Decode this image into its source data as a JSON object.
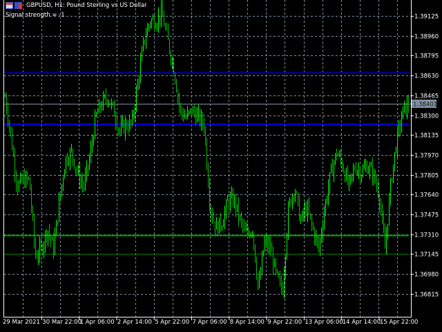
{
  "header": {
    "title": "GBPUSD, H1:  Pound Sterling vs US Dollar",
    "signal": "Signal strength = -1"
  },
  "colors": {
    "background": "#000000",
    "bars": "#00ff00",
    "grid": "#8090a0",
    "line_upper": "#0000c0",
    "line_main": "#0000ff",
    "line_green": "#008000",
    "line_green_low": "#006400",
    "bid_line": "#8090a0"
  },
  "chart_data": {
    "type": "bar",
    "symbol": "GBPUSD",
    "timeframe": "H1",
    "ylim": [
      1.3665,
      1.3926
    ],
    "y_ticks": [
      "1.39125",
      "1.38960",
      "1.38795",
      "1.38630",
      "1.38465",
      "1.38300",
      "1.38135",
      "1.37970",
      "1.37805",
      "1.37640",
      "1.37475",
      "1.37310",
      "1.37145",
      "1.36980",
      "1.36815"
    ],
    "x_ticks": [
      "29 Mar 2021",
      "30 Mar 22:00",
      "1 Apr 06:00",
      "2 Apr 14:00",
      "5 Apr 22:00",
      "7 Apr 06:00",
      "8 Apr 14:00",
      "9 Apr 22:00",
      "13 Apr 06:00",
      "14 Apr 14:00",
      "15 Apr 22:00"
    ],
    "current_price": "1.38401",
    "horizontal_lines": [
      {
        "name": "upper-blue",
        "price": 1.3866,
        "color": "#0000c0"
      },
      {
        "name": "main-blue",
        "price": 1.3823,
        "color": "#0000ff"
      },
      {
        "name": "green",
        "price": 1.373,
        "color": "#00a000"
      },
      {
        "name": "green-low",
        "price": 1.3715,
        "color": "#007000"
      }
    ],
    "price_trace": [
      1.38452,
      1.38107,
      1.37705,
      1.37762,
      1.37762,
      1.3713,
      1.37187,
      1.3736,
      1.37187,
      1.3759,
      1.37935,
      1.37992,
      1.3782,
      1.37705,
      1.37935,
      1.3828,
      1.38395,
      1.38452,
      1.38337,
      1.38165,
      1.38222,
      1.38222,
      1.38567,
      1.38912,
      1.39085,
      1.39085,
      1.39142,
      1.38912,
      1.38682,
      1.38337,
      1.3828,
      1.38337,
      1.3828,
      1.38222,
      1.37532,
      1.3736,
      1.37417,
      1.3759,
      1.3759,
      1.37417,
      1.37302,
      1.3736,
      1.36842,
      1.37245,
      1.37187,
      1.36957,
      1.36842,
      1.37532,
      1.37705,
      1.37417,
      1.37532,
      1.3736,
      1.37187,
      1.37532,
      1.3782,
      1.37992,
      1.37877,
      1.37705,
      1.37877,
      1.3782,
      1.37877,
      1.3782,
      1.37647,
      1.37187,
      1.37762,
      1.38107,
      1.38337,
      1.38395
    ]
  }
}
